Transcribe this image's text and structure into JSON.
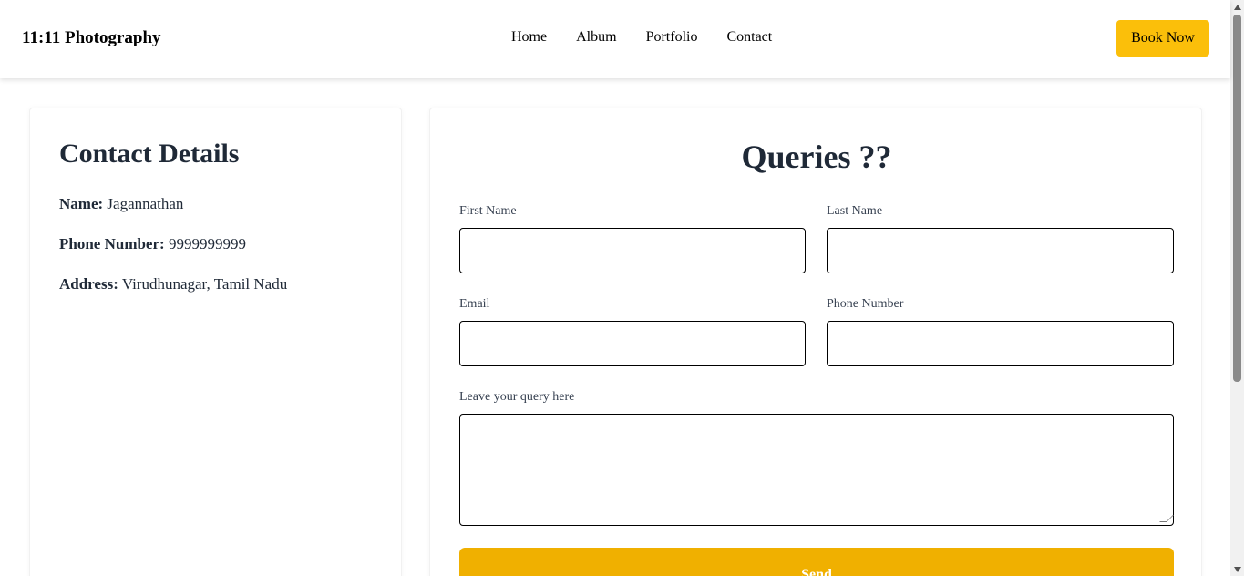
{
  "header": {
    "brand": "11:11 Photography",
    "nav": [
      "Home",
      "Album",
      "Portfolio",
      "Contact"
    ],
    "book_label": "Book Now",
    "accent_color": "#fbbf0a"
  },
  "contact": {
    "title": "Contact Details",
    "name_label": "Name:",
    "name_value": "Jagannathan",
    "phone_label": "Phone Number:",
    "phone_value": "9999999999",
    "address_label": "Address:",
    "address_value": "Virudhunagar, Tamil Nadu"
  },
  "form": {
    "title": "Queries ??",
    "first_name_label": "First Name",
    "last_name_label": "Last Name",
    "email_label": "Email",
    "phone_label": "Phone Number",
    "query_label": "Leave your query here",
    "first_name_value": "",
    "last_name_value": "",
    "email_value": "",
    "phone_value": "",
    "query_value": "",
    "send_label": "Send",
    "send_color": "#f0b000"
  }
}
